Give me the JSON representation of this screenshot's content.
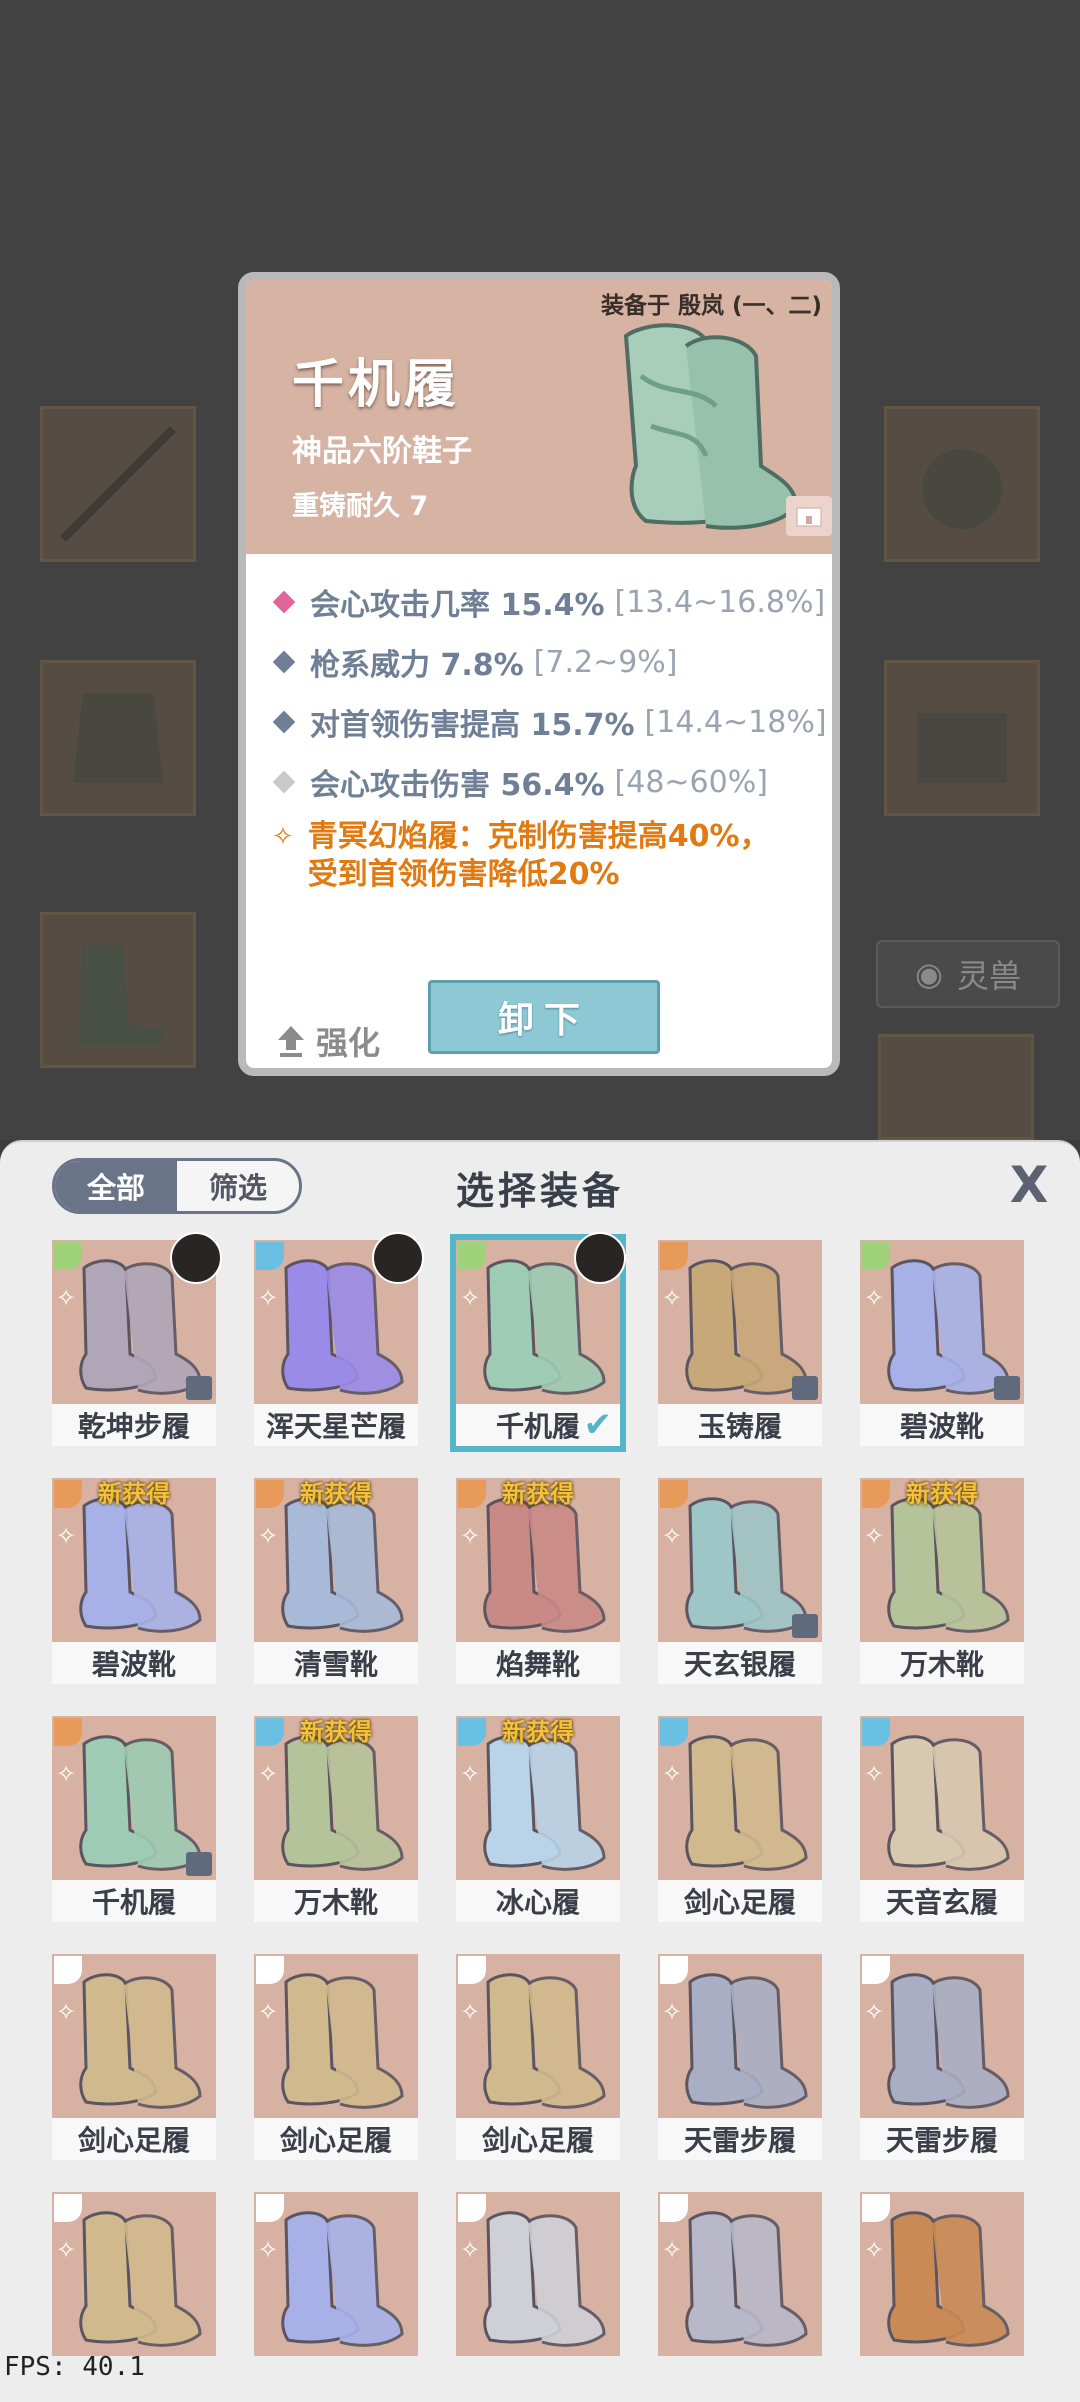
{
  "popup": {
    "equipped_on": "装备于 殷岚 (一、二)",
    "item_name": "千机履",
    "item_type": "神品六阶鞋子",
    "durability": "重铸耐久 7",
    "stats": [
      {
        "text": "会心攻击几率 15.4%",
        "range": "[13.4~16.8%]",
        "color": "#e0669a"
      },
      {
        "text": "枪系威力 7.8%",
        "range": "[7.2~9%]",
        "color": "#6f7f96"
      },
      {
        "text": "对首领伤害提高 15.7%",
        "range": "[14.4~18%]",
        "color": "#6f7f96"
      },
      {
        "text": "会心攻击伤害 56.4%",
        "range": "[48~60%]",
        "color": "#c9c9c9"
      }
    ],
    "set_bonus_line1": "青冥幻焰履：克制伤害提高40%，",
    "set_bonus_line2": "受到首领伤害降低20%",
    "upgrade_label": "强化",
    "unequip_label": "卸下"
  },
  "background": {
    "side_tab": "灵兽"
  },
  "sheet": {
    "tab_all": "全部",
    "tab_filter": "筛选",
    "title": "选择装备",
    "close_label": "X",
    "new_badge": "新获得",
    "items": [
      {
        "name": "乾坤步履",
        "tag": "#9fd07a",
        "avatar": true,
        "chip": true,
        "new": false,
        "color": "#b0a6b8"
      },
      {
        "name": "浑天星芒履",
        "tag": "#6ac0e2",
        "avatar": true,
        "chip": false,
        "new": false,
        "color": "#9b8be8"
      },
      {
        "name": "千机履",
        "tag": "#9fd07a",
        "avatar": true,
        "chip": false,
        "new": false,
        "color": "#9ecbb3",
        "selected": true
      },
      {
        "name": "玉铸履",
        "tag": "#e89a5a",
        "avatar": false,
        "chip": true,
        "new": false,
        "color": "#c7a878"
      },
      {
        "name": "碧波靴",
        "tag": "#9fd07a",
        "avatar": false,
        "chip": true,
        "new": false,
        "color": "#a7b1e8"
      },
      {
        "name": "碧波靴",
        "tag": "#e89a5a",
        "avatar": false,
        "chip": false,
        "new": true,
        "color": "#a7b1e8"
      },
      {
        "name": "清雪靴",
        "tag": "#e89a5a",
        "avatar": false,
        "chip": false,
        "new": true,
        "color": "#a8bad8"
      },
      {
        "name": "焰舞靴",
        "tag": "#e89a5a",
        "avatar": false,
        "chip": false,
        "new": true,
        "color": "#c98a86"
      },
      {
        "name": "天玄银履",
        "tag": "#e89a5a",
        "avatar": false,
        "chip": true,
        "new": false,
        "color": "#9ec6c6"
      },
      {
        "name": "万木靴",
        "tag": "#e89a5a",
        "avatar": false,
        "chip": false,
        "new": true,
        "color": "#b5c39a"
      },
      {
        "name": "千机履",
        "tag": "#e89a5a",
        "avatar": false,
        "chip": true,
        "new": false,
        "color": "#9ecbb3"
      },
      {
        "name": "万木靴",
        "tag": "#6ac0e2",
        "avatar": false,
        "chip": false,
        "new": true,
        "color": "#b5c39a"
      },
      {
        "name": "冰心履",
        "tag": "#6ac0e2",
        "avatar": false,
        "chip": false,
        "new": true,
        "color": "#b9d3e8"
      },
      {
        "name": "剑心足履",
        "tag": "#6ac0e2",
        "avatar": false,
        "chip": false,
        "new": false,
        "color": "#d1b98e"
      },
      {
        "name": "天音玄履",
        "tag": "#6ac0e2",
        "avatar": false,
        "chip": false,
        "new": false,
        "color": "#d9c8b0"
      },
      {
        "name": "剑心足履",
        "tag": "#ffffff",
        "avatar": false,
        "chip": false,
        "new": false,
        "color": "#d1b98e"
      },
      {
        "name": "剑心足履",
        "tag": "#ffffff",
        "avatar": false,
        "chip": false,
        "new": false,
        "color": "#d1b98e"
      },
      {
        "name": "剑心足履",
        "tag": "#ffffff",
        "avatar": false,
        "chip": false,
        "new": false,
        "color": "#d1b98e"
      },
      {
        "name": "天雷步履",
        "tag": "#ffffff",
        "avatar": false,
        "chip": false,
        "new": false,
        "color": "#a9aec4"
      },
      {
        "name": "天雷步履",
        "tag": "#ffffff",
        "avatar": false,
        "chip": false,
        "new": false,
        "color": "#a9aec4"
      },
      {
        "name": "",
        "tag": "#ffffff",
        "avatar": false,
        "chip": false,
        "new": false,
        "color": "#d1b98e"
      },
      {
        "name": "",
        "tag": "#ffffff",
        "avatar": false,
        "chip": false,
        "new": false,
        "color": "#a7b1e8"
      },
      {
        "name": "",
        "tag": "#ffffff",
        "avatar": false,
        "chip": false,
        "new": false,
        "color": "#cfcfd8"
      },
      {
        "name": "",
        "tag": "#ffffff",
        "avatar": false,
        "chip": false,
        "new": false,
        "color": "#b8b8c8"
      },
      {
        "name": "",
        "tag": "#ffffff",
        "avatar": false,
        "chip": false,
        "new": false,
        "color": "#c98a56"
      }
    ]
  },
  "fps": "FPS: 40.1"
}
